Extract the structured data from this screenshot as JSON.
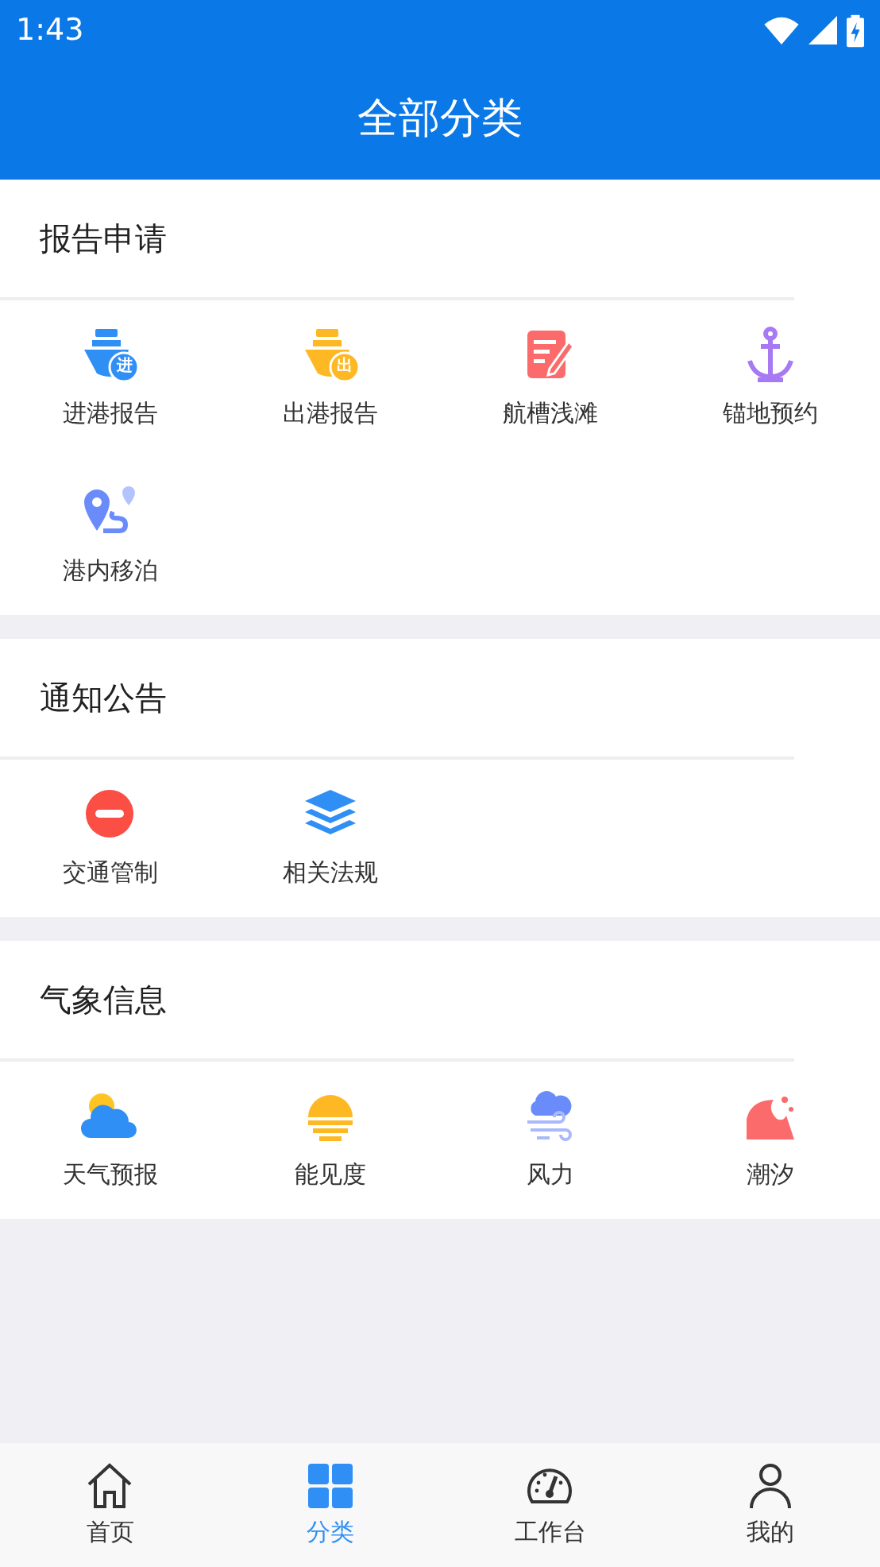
{
  "status_bar": {
    "time": "1:43"
  },
  "header": {
    "title": "全部分类"
  },
  "sections": [
    {
      "title": "报告申请",
      "items": [
        {
          "label": "进港报告",
          "kind": "ship",
          "color": "#2f8ff5",
          "badge": "进"
        },
        {
          "label": "出港报告",
          "kind": "ship",
          "color": "#fdb823",
          "badge": "出"
        },
        {
          "label": "航槽浅滩",
          "kind": "note",
          "color": "#fb6b6b"
        },
        {
          "label": "锚地预约",
          "kind": "anchor",
          "color": "#a77af4"
        },
        {
          "label": "港内移泊",
          "kind": "route",
          "color": "#6a8cfb"
        }
      ]
    },
    {
      "title": "通知公告",
      "items": [
        {
          "label": "交通管制",
          "kind": "noentry",
          "color": "#fb4e44"
        },
        {
          "label": "相关法规",
          "kind": "layers",
          "color": "#2f8ff5"
        }
      ]
    },
    {
      "title": "气象信息",
      "items": [
        {
          "label": "天气预报",
          "kind": "weather",
          "color": "#2f8ff5"
        },
        {
          "label": "能见度",
          "kind": "sun",
          "color": "#fdb823"
        },
        {
          "label": "风力",
          "kind": "wind",
          "color": "#6a8cfb"
        },
        {
          "label": "潮汐",
          "kind": "wave",
          "color": "#fb6b6b"
        }
      ]
    }
  ],
  "tabs": [
    {
      "label": "首页",
      "kind": "home",
      "selected": false
    },
    {
      "label": "分类",
      "kind": "grid",
      "selected": true
    },
    {
      "label": "工作台",
      "kind": "gauge",
      "selected": false
    },
    {
      "label": "我的",
      "kind": "person",
      "selected": false
    }
  ]
}
